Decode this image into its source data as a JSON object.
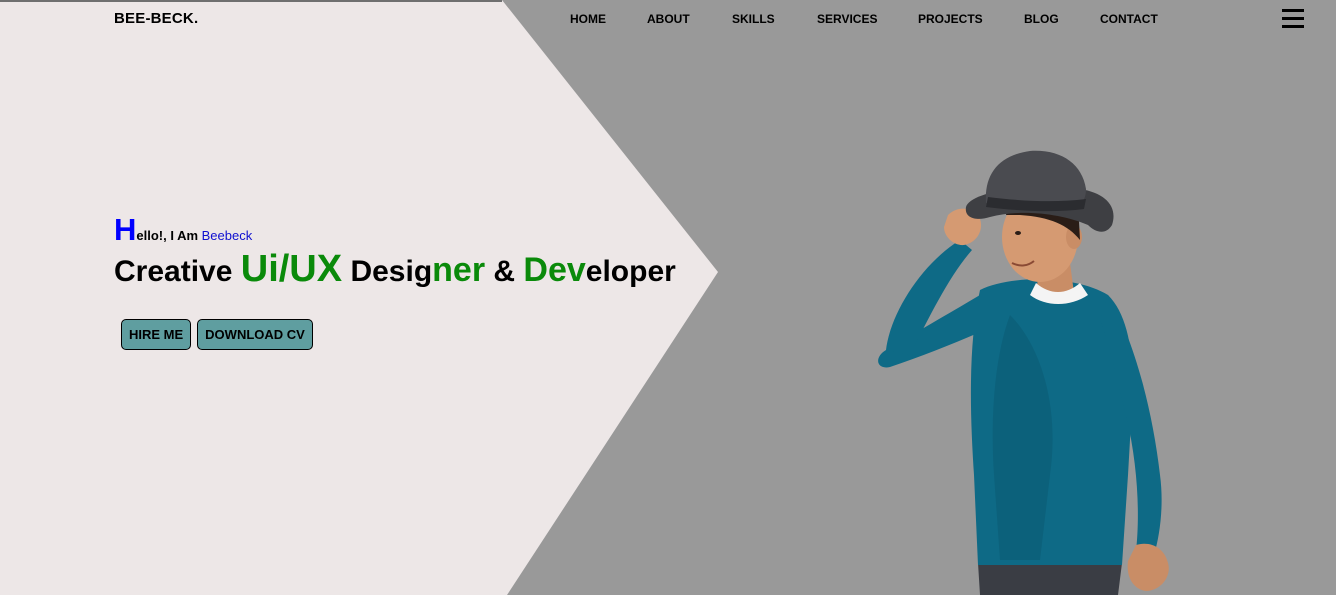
{
  "brand": "BEE-BECK.",
  "nav": {
    "items": [
      {
        "label": "HOME"
      },
      {
        "label": "ABOUT"
      },
      {
        "label": "SKILLS"
      },
      {
        "label": "SERVICES"
      },
      {
        "label": "PROJECTS"
      },
      {
        "label": "BLOG"
      },
      {
        "label": "CONTACT"
      }
    ],
    "menu_icon": "hamburger-icon"
  },
  "hero": {
    "greeting": {
      "first_letter": "H",
      "rest": "ello!, I Am ",
      "name": "Beebeck"
    },
    "headline": {
      "part1": "Creative ",
      "part2": "Ui/UX",
      "part3": " Desig",
      "part4": "ner",
      "part5": " & ",
      "part6": "Dev",
      "part7": "eloper"
    },
    "buttons": {
      "hire": "HIRE ME",
      "download": "DOWNLOAD CV"
    },
    "image": "boy-in-hat-portrait"
  },
  "colors": {
    "background_dark": "#999999",
    "background_light": "#ede7e7",
    "accent_blue": "#0000ff",
    "accent_green": "#0a8a0a",
    "button_bg": "#5f9ea0"
  }
}
